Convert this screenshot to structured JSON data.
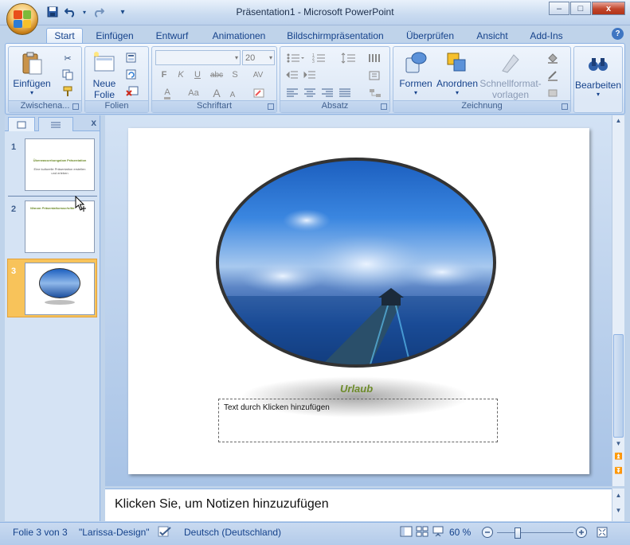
{
  "window": {
    "title": "Präsentation1 - Microsoft PowerPoint",
    "minimize": "–",
    "maximize": "□",
    "close": "x"
  },
  "quick_access": {
    "save_icon": "save-icon",
    "undo_icon": "undo-icon",
    "redo_icon": "redo-icon",
    "customize": "▾"
  },
  "tabs": [
    "Start",
    "Einfügen",
    "Entwurf",
    "Animationen",
    "Bildschirmpräsentation",
    "Überprüfen",
    "Ansicht",
    "Add-Ins"
  ],
  "active_tab": "Start",
  "ribbon": {
    "clipboard": {
      "paste": "Einfügen",
      "label": "Zwischena..."
    },
    "slides": {
      "new_slide_line1": "Neue",
      "new_slide_line2": "Folie",
      "label": "Folien"
    },
    "font": {
      "font_name": "",
      "font_size": "20",
      "bold": "F",
      "italic": "K",
      "underline": "U",
      "strike": "abc",
      "shadow": "S",
      "spacing": "AV",
      "change_case": "Aa",
      "grow": "A",
      "shrink": "A",
      "clear": "A",
      "label": "Schriftart"
    },
    "paragraph": {
      "label": "Absatz"
    },
    "drawing": {
      "shapes": "Formen",
      "arrange": "Anordnen",
      "quickstyles_line1": "Schnellformat-",
      "quickstyles_line2": "vorlagen",
      "label": "Zeichnung"
    },
    "editing": {
      "edit": "Bearbeiten"
    }
  },
  "slides_pane": {
    "close": "x",
    "thumbs": [
      {
        "number": "1",
        "title": "Überwasserbungalow Präsentation",
        "subtitle": "Eine kulturelle Präsentation erstellen und erleben"
      },
      {
        "number": "2",
        "title": "Warum Präsentationsschritte"
      },
      {
        "number": "3",
        "title": ""
      }
    ]
  },
  "slide": {
    "caption": "Urlaub",
    "text_placeholder": "Text durch Klicken hinzufügen"
  },
  "notes": {
    "placeholder": "Klicken Sie, um Notizen hinzuzufügen"
  },
  "statusbar": {
    "slide_info": "Folie 3 von 3",
    "design": "\"Larissa-Design\"",
    "language": "Deutsch (Deutschland)",
    "zoom": "60 %"
  },
  "colors": {
    "accent": "#15428b",
    "ribbon_bg": "#dce8f7",
    "caption": "#6d8b2a",
    "selected_thumb": "#f8c35a"
  }
}
